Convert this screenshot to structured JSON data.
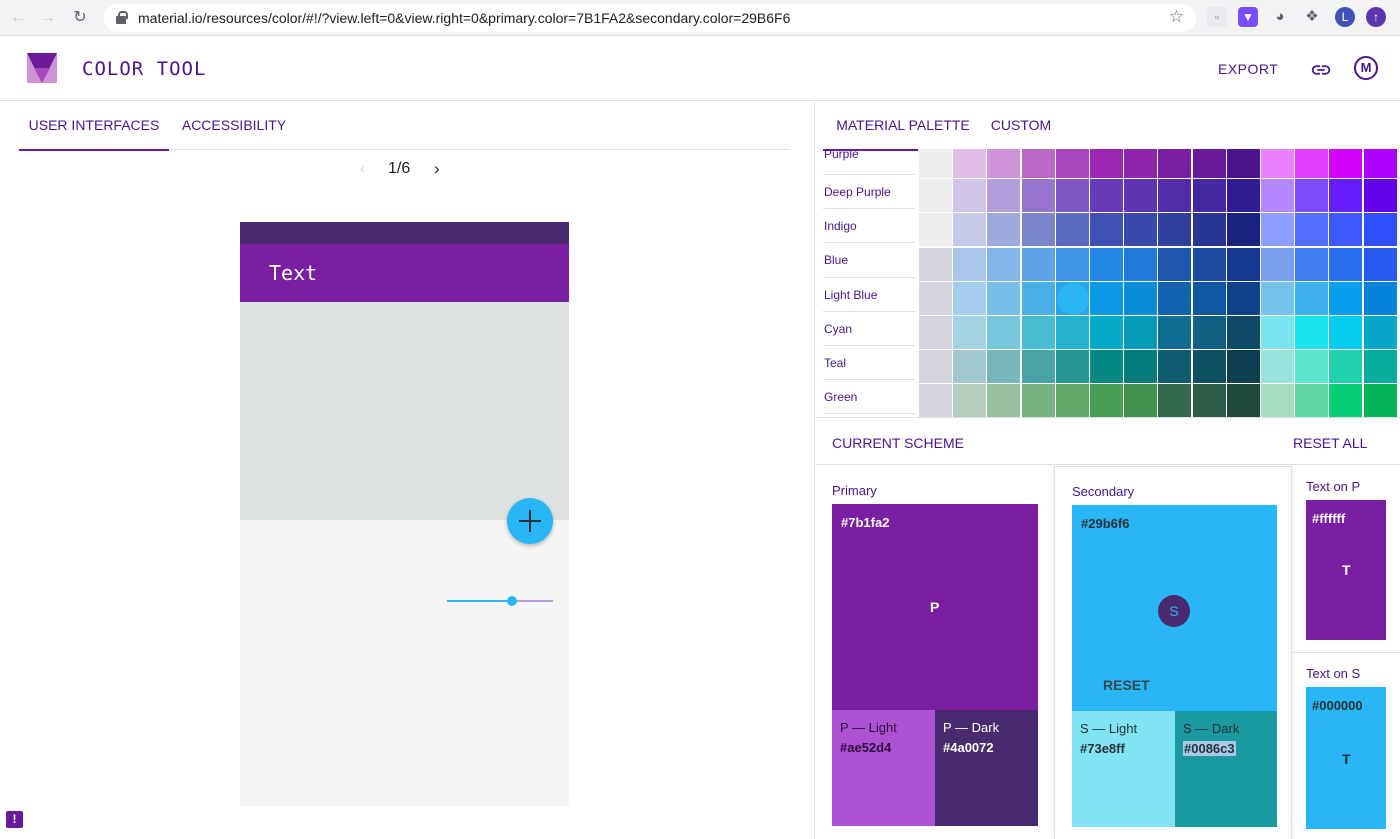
{
  "browser": {
    "url": "material.io/resources/color/#!/?view.left=0&view.right=0&primary.color=7B1FA2&secondary.color=29B6F6",
    "profile_initial": "L"
  },
  "app": {
    "title": "COLOR TOOL",
    "export_label": "EXPORT"
  },
  "left": {
    "tabs": [
      {
        "label": "USER INTERFACES"
      },
      {
        "label": "ACCESSIBILITY"
      }
    ],
    "pager": "1/6",
    "phone": {
      "appbar_title": "Text",
      "slider_value": 0.6
    }
  },
  "right": {
    "tabs": [
      {
        "label": "MATERIAL PALETTE"
      },
      {
        "label": "CUSTOM"
      }
    ],
    "palette_rows": [
      {
        "name": "Purple"
      },
      {
        "name": "Deep Purple"
      },
      {
        "name": "Indigo"
      },
      {
        "name": "Blue"
      },
      {
        "name": "Light Blue"
      },
      {
        "name": "Cyan"
      },
      {
        "name": "Teal"
      },
      {
        "name": "Green"
      }
    ],
    "scheme": {
      "title": "CURRENT SCHEME",
      "reset_all": "RESET ALL",
      "primary": {
        "label": "Primary",
        "hex": "#7b1fa2",
        "letter": "P",
        "light_label": "P — Light",
        "light_hex": "#ae52d4",
        "dark_label": "P — Dark",
        "dark_hex": "#4a0072"
      },
      "secondary": {
        "label": "Secondary",
        "hex": "#29b6f6",
        "letter": "S",
        "reset": "RESET",
        "light_label": "S — Light",
        "light_hex": "#73e8ff",
        "dark_label": "S — Dark",
        "dark_hex": "#0086c3"
      },
      "text_on_p": {
        "label": "Text on P",
        "hex": "#ffffff",
        "letter": "T"
      },
      "text_on_s": {
        "label": "Text on S",
        "hex": "#000000",
        "letter": "T"
      }
    }
  },
  "colors": {
    "primary": "#7b1fa2",
    "primary_light": "#ae52d4",
    "primary_dark": "#4a0072",
    "secondary": "#29b6f6",
    "secondary_light": "#73e8ff",
    "secondary_dark": "#0086c3"
  }
}
